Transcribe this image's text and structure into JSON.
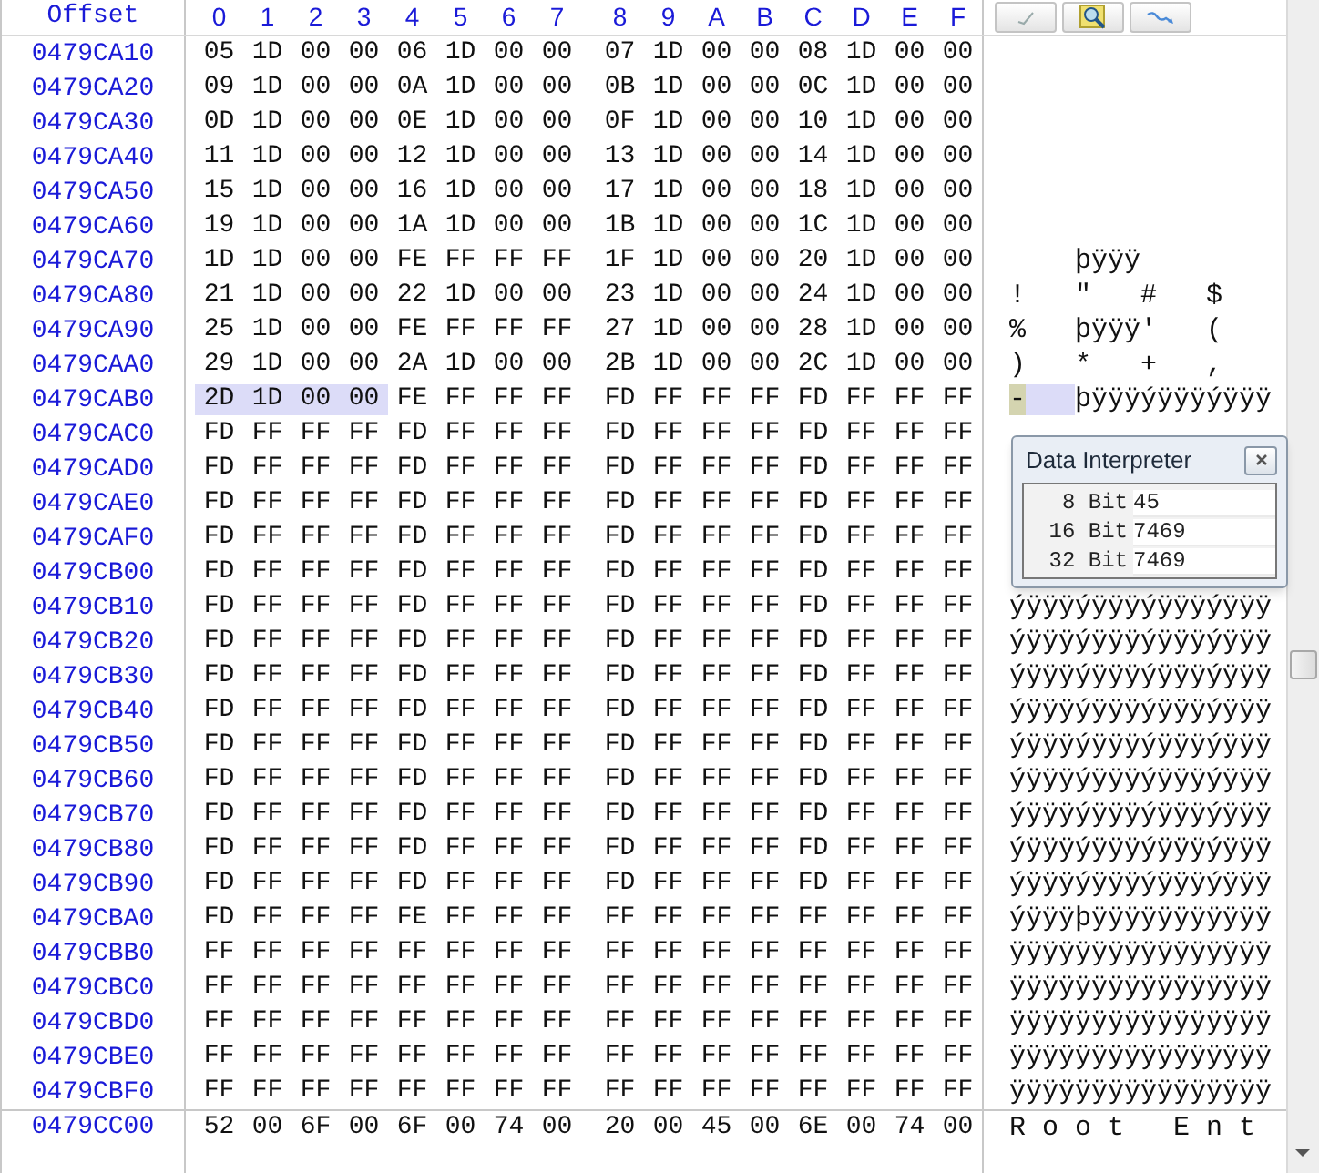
{
  "header": {
    "offset_label": "Offset",
    "hex_labels": [
      "0",
      "1",
      "2",
      "3",
      "4",
      "5",
      "6",
      "7",
      "8",
      "9",
      "A",
      "B",
      "C",
      "D",
      "E",
      "F"
    ]
  },
  "toolbar": [
    {
      "kind": "check"
    },
    {
      "kind": "search"
    },
    {
      "kind": "wave"
    }
  ],
  "rows": [
    {
      "offset": "0479CA10",
      "bytes": "05 1D 00 00 06 1D 00 00 07 1D 00 00 08 1D 00 00",
      "selected": false
    },
    {
      "offset": "0479CA20",
      "bytes": "09 1D 00 00 0A 1D 00 00 0B 1D 00 00 0C 1D 00 00",
      "selected": false
    },
    {
      "offset": "0479CA30",
      "bytes": "0D 1D 00 00 0E 1D 00 00 0F 1D 00 00 10 1D 00 00",
      "selected": false
    },
    {
      "offset": "0479CA40",
      "bytes": "11 1D 00 00 12 1D 00 00 13 1D 00 00 14 1D 00 00",
      "selected": false
    },
    {
      "offset": "0479CA50",
      "bytes": "15 1D 00 00 16 1D 00 00 17 1D 00 00 18 1D 00 00",
      "selected": false
    },
    {
      "offset": "0479CA60",
      "bytes": "19 1D 00 00 1A 1D 00 00 1B 1D 00 00 1C 1D 00 00",
      "selected": false
    },
    {
      "offset": "0479CA70",
      "bytes": "1D 1D 00 00 FE FF FF FF 1F 1D 00 00 20 1D 00 00",
      "text": "    þÿÿÿ",
      "selected": false
    },
    {
      "offset": "0479CA80",
      "bytes": "21 1D 00 00 22 1D 00 00 23 1D 00 00 24 1D 00 00",
      "text": "!   \"   #   $",
      "selected": false
    },
    {
      "offset": "0479CA90",
      "bytes": "25 1D 00 00 FE FF FF FF 27 1D 00 00 28 1D 00 00",
      "text": "%   þÿÿÿ'   (",
      "selected": false
    },
    {
      "offset": "0479CAA0",
      "bytes": "29 1D 00 00 2A 1D 00 00 2B 1D 00 00 2C 1D 00 00",
      "text": ")   *   +   ,",
      "selected": false
    },
    {
      "offset": "0479CAB0",
      "bytes": "2D 1D 00 00 FE FF FF FF FD FF FF FF FD FF FF FF",
      "text": "-   þÿÿÿýÿÿÿýÿÿÿ",
      "selected": true
    },
    {
      "offset": "0479CAC0",
      "bytes": "FD FF FF FF FD FF FF FF FD FF FF FF FD FF FF FF",
      "selected": false
    },
    {
      "offset": "0479CAD0",
      "bytes": "FD FF FF FF FD FF FF FF FD FF FF FF FD FF FF FF",
      "selected": false
    },
    {
      "offset": "0479CAE0",
      "bytes": "FD FF FF FF FD FF FF FF FD FF FF FF FD FF FF FF",
      "selected": false
    },
    {
      "offset": "0479CAF0",
      "bytes": "FD FF FF FF FD FF FF FF FD FF FF FF FD FF FF FF",
      "selected": false
    },
    {
      "offset": "0479CB00",
      "bytes": "FD FF FF FF FD FF FF FF FD FF FF FF FD FF FF FF",
      "selected": false
    },
    {
      "offset": "0479CB10",
      "bytes": "FD FF FF FF FD FF FF FF FD FF FF FF FD FF FF FF",
      "text": "ýÿÿÿýÿÿÿýÿÿÿýÿÿÿ",
      "selected": false
    },
    {
      "offset": "0479CB20",
      "bytes": "FD FF FF FF FD FF FF FF FD FF FF FF FD FF FF FF",
      "text": "ýÿÿÿýÿÿÿýÿÿÿýÿÿÿ",
      "selected": false
    },
    {
      "offset": "0479CB30",
      "bytes": "FD FF FF FF FD FF FF FF FD FF FF FF FD FF FF FF",
      "text": "ýÿÿÿýÿÿÿýÿÿÿýÿÿÿ",
      "selected": false
    },
    {
      "offset": "0479CB40",
      "bytes": "FD FF FF FF FD FF FF FF FD FF FF FF FD FF FF FF",
      "text": "ýÿÿÿýÿÿÿýÿÿÿýÿÿÿ",
      "selected": false
    },
    {
      "offset": "0479CB50",
      "bytes": "FD FF FF FF FD FF FF FF FD FF FF FF FD FF FF FF",
      "text": "ýÿÿÿýÿÿÿýÿÿÿýÿÿÿ",
      "selected": false
    },
    {
      "offset": "0479CB60",
      "bytes": "FD FF FF FF FD FF FF FF FD FF FF FF FD FF FF FF",
      "text": "ýÿÿÿýÿÿÿýÿÿÿýÿÿÿ",
      "selected": false
    },
    {
      "offset": "0479CB70",
      "bytes": "FD FF FF FF FD FF FF FF FD FF FF FF FD FF FF FF",
      "text": "ýÿÿÿýÿÿÿýÿÿÿýÿÿÿ",
      "selected": false
    },
    {
      "offset": "0479CB80",
      "bytes": "FD FF FF FF FD FF FF FF FD FF FF FF FD FF FF FF",
      "text": "ýÿÿÿýÿÿÿýÿÿÿýÿÿÿ",
      "selected": false
    },
    {
      "offset": "0479CB90",
      "bytes": "FD FF FF FF FD FF FF FF FD FF FF FF FD FF FF FF",
      "text": "ýÿÿÿýÿÿÿýÿÿÿýÿÿÿ",
      "selected": false
    },
    {
      "offset": "0479CBA0",
      "bytes": "FD FF FF FF FE FF FF FF FF FF FF FF FF FF FF FF",
      "text": "ýÿÿÿþÿÿÿÿÿÿÿÿÿÿÿ",
      "selected": false
    },
    {
      "offset": "0479CBB0",
      "bytes": "FF FF FF FF FF FF FF FF FF FF FF FF FF FF FF FF",
      "text": "ÿÿÿÿÿÿÿÿÿÿÿÿÿÿÿÿ",
      "selected": false
    },
    {
      "offset": "0479CBC0",
      "bytes": "FF FF FF FF FF FF FF FF FF FF FF FF FF FF FF FF",
      "text": "ÿÿÿÿÿÿÿÿÿÿÿÿÿÿÿÿ",
      "selected": false
    },
    {
      "offset": "0479CBD0",
      "bytes": "FF FF FF FF FF FF FF FF FF FF FF FF FF FF FF FF",
      "text": "ÿÿÿÿÿÿÿÿÿÿÿÿÿÿÿÿ",
      "selected": false
    },
    {
      "offset": "0479CBE0",
      "bytes": "FF FF FF FF FF FF FF FF FF FF FF FF FF FF FF FF",
      "text": "ÿÿÿÿÿÿÿÿÿÿÿÿÿÿÿÿ",
      "selected": false
    },
    {
      "offset": "0479CBF0",
      "bytes": "FF FF FF FF FF FF FF FF FF FF FF FF FF FF FF FF",
      "text": "ÿÿÿÿÿÿÿÿÿÿÿÿÿÿÿÿ",
      "selected": false
    }
  ],
  "bottom_row": {
    "offset": "0479CC00",
    "bytes": "52 00 6F 00 6F 00 74 00 20 00 45 00 6E 00 74 00",
    "text": "R o o t   E n t"
  },
  "data_interpreter": {
    "title": "Data Interpreter",
    "rows": [
      {
        "label": "8 Bit",
        "value": "45"
      },
      {
        "label": "16 Bit",
        "value": "7469"
      },
      {
        "label": "32 Bit",
        "value": "7469"
      }
    ]
  }
}
